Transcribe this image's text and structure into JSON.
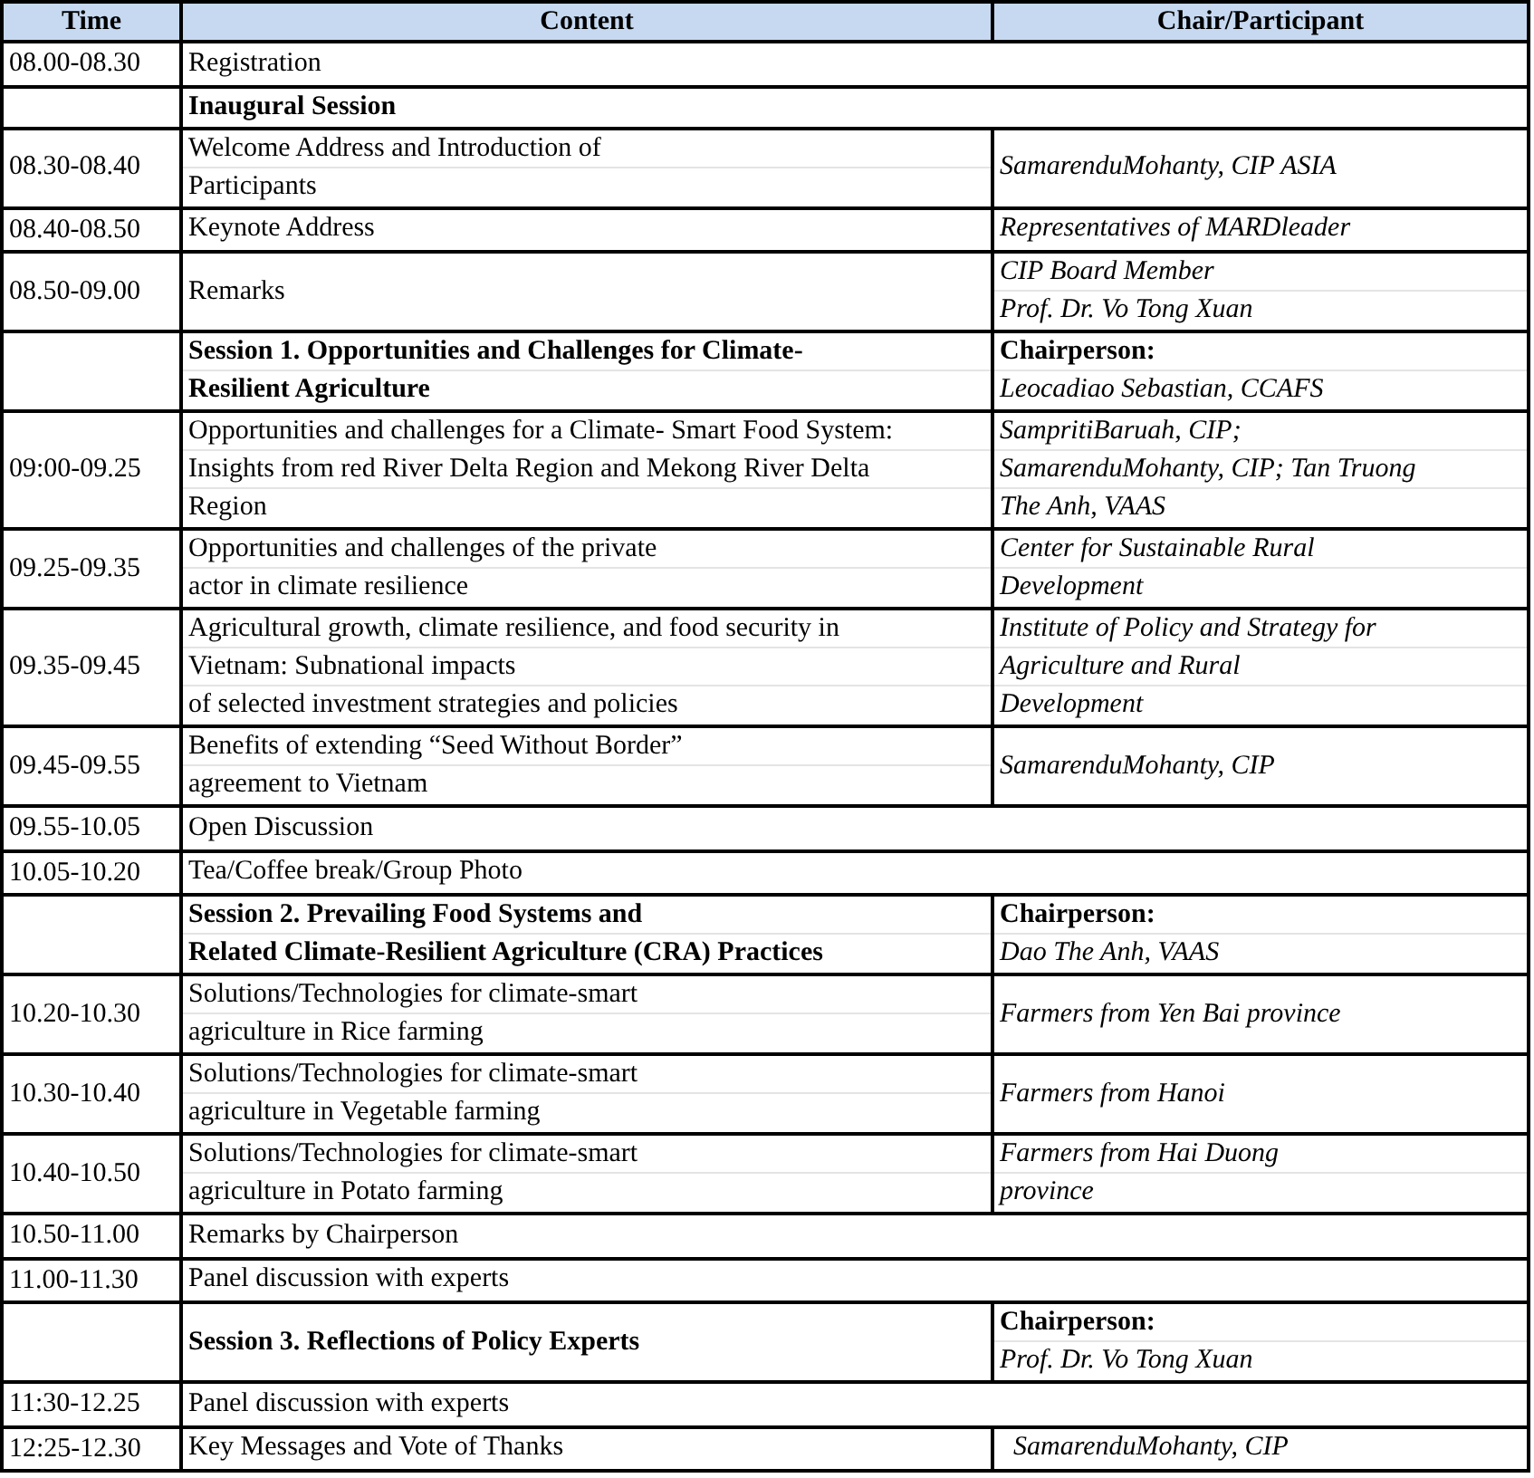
{
  "table": {
    "columns": [
      "Time",
      "Content",
      "Chair/Participant"
    ],
    "rows": [
      {
        "time": "08.00-08.30",
        "content": [
          "Registration"
        ],
        "bold": false,
        "chair": []
      },
      {
        "time": "",
        "content": [
          "Inaugural Session"
        ],
        "bold": true,
        "chair": []
      },
      {
        "time": "08.30-08.40",
        "content": [
          "Welcome Address and Introduction of",
          "Participants"
        ],
        "bold": false,
        "chair": [
          {
            "kind": "name",
            "text": "SamarenduMohanty, CIP ASIA"
          }
        ]
      },
      {
        "time": "08.40-08.50",
        "content": [
          "Keynote Address"
        ],
        "bold": false,
        "chair": [
          {
            "kind": "name",
            "text": "Representatives of MARDleader"
          }
        ]
      },
      {
        "time": "08.50-09.00",
        "content": [
          "Remarks"
        ],
        "bold": false,
        "chair": [
          {
            "kind": "name",
            "text": "CIP Board Member"
          },
          {
            "kind": "name",
            "text": "Prof. Dr. Vo Tong Xuan"
          }
        ]
      },
      {
        "time": "",
        "content": [
          "Session 1. Opportunities and Challenges for Climate-",
          "Resilient Agriculture"
        ],
        "bold": true,
        "chair": [
          {
            "kind": "role",
            "text": "Chairperson:"
          },
          {
            "kind": "name",
            "text": "Leocadiao Sebastian, CCAFS"
          }
        ]
      },
      {
        "time": "09:00-09.25",
        "content": [
          "Opportunities and challenges for a Climate- Smart Food System:",
          "Insights from red River Delta Region and Mekong River Delta",
          "Region"
        ],
        "bold": false,
        "chair": [
          {
            "kind": "name",
            "text": "SampritiBaruah, CIP;"
          },
          {
            "kind": "name",
            "text": "SamarenduMohanty, CIP; Tan Truong"
          },
          {
            "kind": "name",
            "text": "The Anh, VAAS"
          }
        ]
      },
      {
        "time": "09.25-09.35",
        "content": [
          "Opportunities and challenges of the private",
          "actor in climate resilience"
        ],
        "bold": false,
        "chair": [
          {
            "kind": "name",
            "text": "Center for Sustainable Rural"
          },
          {
            "kind": "name",
            "text": "Development"
          }
        ]
      },
      {
        "time": "09.35-09.45",
        "content": [
          "Agricultural growth, climate resilience, and food security in",
          "Vietnam: Subnational impacts",
          "of selected investment strategies and policies"
        ],
        "bold": false,
        "chair": [
          {
            "kind": "name",
            "text": "Institute of Policy and Strategy for"
          },
          {
            "kind": "name",
            "text": "Agriculture and Rural"
          },
          {
            "kind": "name",
            "text": "Development"
          }
        ]
      },
      {
        "time": "09.45-09.55",
        "content": [
          "Benefits of extending “Seed Without Border”",
          "agreement to Vietnam"
        ],
        "bold": false,
        "chair": [
          {
            "kind": "name",
            "text": "SamarenduMohanty, CIP"
          }
        ]
      },
      {
        "time": "09.55-10.05",
        "content": [
          "Open Discussion"
        ],
        "bold": false,
        "chair": []
      },
      {
        "time": "10.05-10.20",
        "content": [
          "Tea/Coffee break/Group Photo"
        ],
        "bold": false,
        "chair": []
      },
      {
        "time": "",
        "content": [
          "Session 2. Prevailing Food Systems and",
          "Related Climate-Resilient Agriculture (CRA) Practices"
        ],
        "bold": true,
        "chair": [
          {
            "kind": "role",
            "text": "Chairperson:"
          },
          {
            "kind": "name",
            "text": "Dao The Anh, VAAS"
          }
        ]
      },
      {
        "time": "10.20-10.30",
        "content": [
          "Solutions/Technologies for climate-smart",
          "agriculture in Rice farming"
        ],
        "bold": false,
        "chair": [
          {
            "kind": "name",
            "text": "Farmers from Yen Bai province"
          }
        ]
      },
      {
        "time": "10.30-10.40",
        "content": [
          "Solutions/Technologies for climate-smart",
          "agriculture in Vegetable farming"
        ],
        "bold": false,
        "chair": [
          {
            "kind": "name",
            "text": "Farmers from Hanoi"
          }
        ]
      },
      {
        "time": "10.40-10.50",
        "content": [
          "Solutions/Technologies for climate-smart",
          "agriculture in Potato farming"
        ],
        "bold": false,
        "chair": [
          {
            "kind": "name",
            "text": "Farmers from Hai Duong"
          },
          {
            "kind": "name",
            "text": "province"
          }
        ]
      },
      {
        "time": "10.50-11.00",
        "content": [
          "Remarks by Chairperson"
        ],
        "bold": false,
        "chair": []
      },
      {
        "time": "11.00-11.30",
        "content": [
          "Panel discussion with experts"
        ],
        "bold": false,
        "chair": []
      },
      {
        "time": "",
        "content": [
          "Session 3. Reflections of Policy Experts"
        ],
        "bold": true,
        "chair": [
          {
            "kind": "role",
            "text": "Chairperson:"
          },
          {
            "kind": "name",
            "text": "Prof. Dr. Vo Tong Xuan"
          }
        ]
      },
      {
        "time": "11:30-12.25",
        "content": [
          "Panel discussion with experts"
        ],
        "bold": false,
        "chair": []
      },
      {
        "time": "12:25-12.30",
        "content": [
          "Key Messages and Vote of Thanks"
        ],
        "bold": false,
        "chair": [
          {
            "kind": "name",
            "text": "  SamarenduMohanty, CIP"
          }
        ]
      }
    ]
  }
}
